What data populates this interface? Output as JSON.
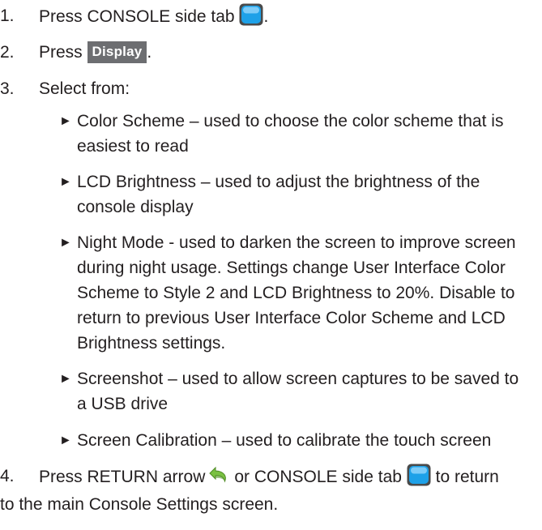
{
  "steps": [
    {
      "number": "1.",
      "text_before": "Press CONSOLE side tab",
      "icon": "console-tab-icon",
      "text_after": "."
    },
    {
      "number": "2.",
      "text_before": "Press",
      "button_label": "Display",
      "text_after": "."
    },
    {
      "number": "3.",
      "text": "Select from:",
      "options": [
        {
          "bullet": "►",
          "lines": [
            "Color Scheme – used to choose the color scheme that is",
            "easiest to read"
          ]
        },
        {
          "bullet": "►",
          "lines": [
            "LCD Brightness – used to adjust the brightness of the",
            "console display"
          ]
        },
        {
          "bullet": "►",
          "lines": [
            "Night Mode - used to darken the screen to improve screen",
            "during night usage. Settings change User Interface Color",
            "Scheme to Style 2 and LCD Brightness to 20%. Disable to",
            "return to previous User Interface Color Scheme and LCD",
            "Brightness settings."
          ]
        },
        {
          "bullet": "►",
          "lines": [
            "Screenshot – used to allow screen captures to be saved to",
            "a USB drive"
          ]
        },
        {
          "bullet": "►",
          "lines": [
            "Screen Calibration – used to calibrate the touch screen"
          ]
        }
      ]
    },
    {
      "number": "4.",
      "text_part1": "Press RETURN arrow",
      "return_icon": "return-arrow-icon",
      "text_part2": "or CONSOLE side tab",
      "icon": "console-tab-icon",
      "text_part3": "to return",
      "line2": "to the main Console Settings screen."
    }
  ],
  "colors": {
    "text": "#231f20",
    "button_bg": "#6d6e71",
    "button_text": "#ffffff",
    "tab_icon_fill": "#1ea1e8",
    "return_icon_fill": "#7ac142"
  }
}
